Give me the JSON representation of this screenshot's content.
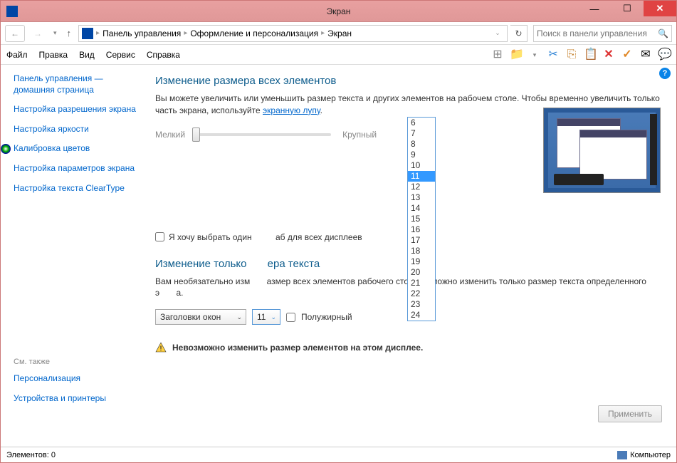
{
  "window": {
    "title": "Экран"
  },
  "nav": {
    "breadcrumb": [
      "Панель управления",
      "Оформление и персонализация",
      "Экран"
    ],
    "search_placeholder": "Поиск в панели управления"
  },
  "menu": {
    "items": [
      "Файл",
      "Правка",
      "Вид",
      "Сервис",
      "Справка"
    ]
  },
  "sidebar": {
    "items": [
      "Панель управления — домашняя страница",
      "Настройка разрешения экрана",
      "Настройка яркости",
      "Калибровка цветов",
      "Настройка параметров экрана",
      "Настройка текста ClearType"
    ],
    "see_also_label": "См. также",
    "see_also": [
      "Персонализация",
      "Устройства и принтеры"
    ]
  },
  "main": {
    "heading1": "Изменение размера всех элементов",
    "desc1a": "Вы можете увеличить или уменьшить размер текста и других элементов на рабочем столе. Чтобы временно увеличить только часть экрана, используйте ",
    "desc1_link": "экранную лупу",
    "slider_min": "Мелкий",
    "slider_max": "Крупный",
    "checkbox_label_before": "Я хочу выбрать один",
    "checkbox_label_after": "аб для всех дисплеев",
    "heading2_before": "Изменение только",
    "heading2_after": "ера текста",
    "desc2_before": "Вам необязательно изм",
    "desc2_mid": "азмер всех элементов рабочего стола — можно изменить только размер текста определенного э",
    "desc2_after": "а.",
    "select_element": "Заголовки окон",
    "select_size": "11",
    "bold_label": "Полужирный",
    "size_options": [
      "6",
      "7",
      "8",
      "9",
      "10",
      "11",
      "12",
      "13",
      "14",
      "15",
      "16",
      "17",
      "18",
      "19",
      "20",
      "21",
      "22",
      "23",
      "24"
    ],
    "selected_size": "11",
    "warning": "Невозможно изменить размер элементов на этом дисплее.",
    "apply": "Применить"
  },
  "statusbar": {
    "elements": "Элементов: 0",
    "computer": "Компьютер"
  }
}
